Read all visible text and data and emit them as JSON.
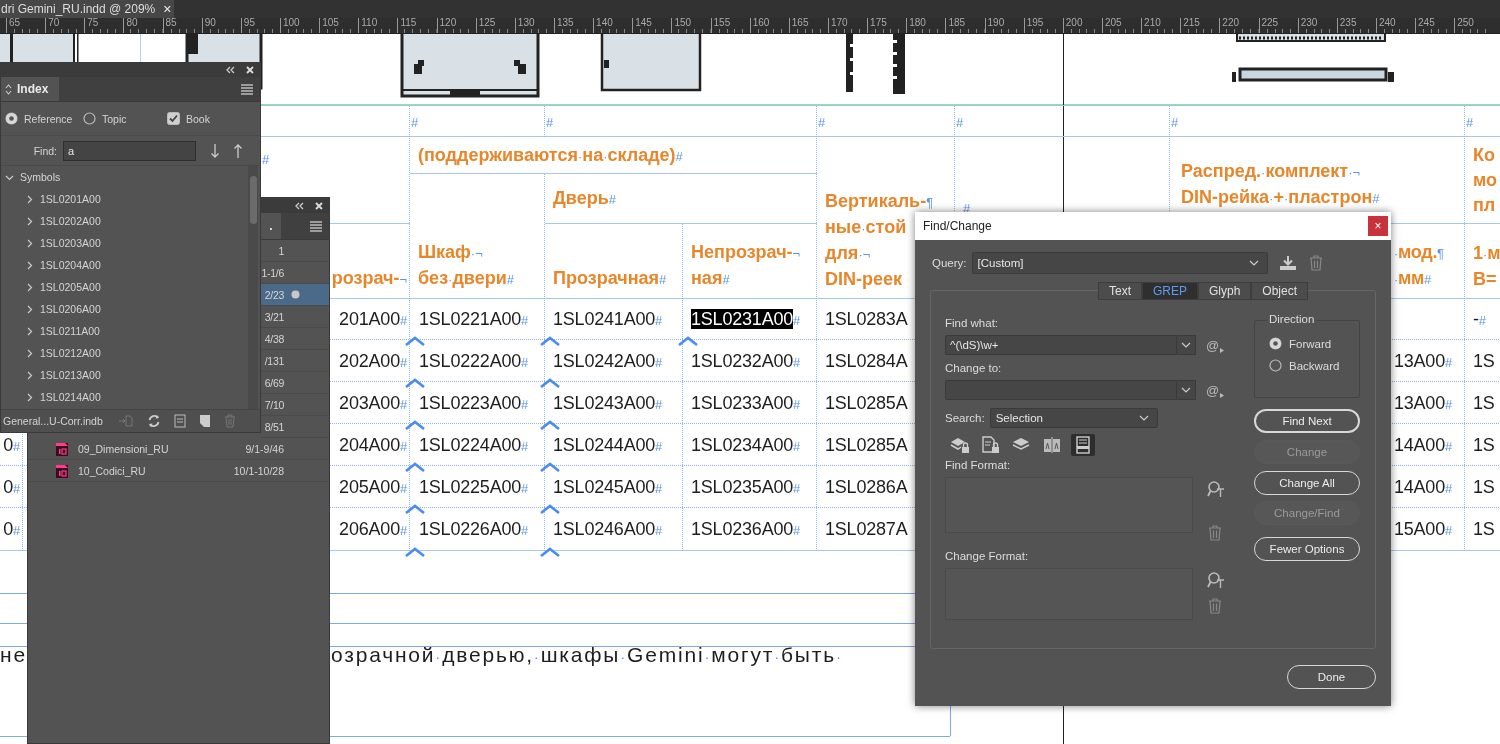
{
  "document_tab": {
    "title": "dri Gemini_RU.indd @ 209%",
    "close": "×"
  },
  "ruler": {
    "labels": [
      "65",
      "70",
      "75",
      "80",
      "85",
      "90",
      "95",
      "100",
      "105",
      "110",
      "115",
      "120",
      "125",
      "130",
      "135",
      "140",
      "145",
      "150",
      "155",
      "160",
      "165",
      "170",
      "175",
      "180",
      "185",
      "190",
      "195",
      "200",
      "205",
      "210",
      "215",
      "220",
      "225",
      "230",
      "235",
      "240",
      "245",
      "250"
    ]
  },
  "table": {
    "header_cells": [
      {
        "text": "#"
      },
      {
        "text": "#"
      },
      {
        "text": "#"
      },
      {
        "text": "#"
      },
      {
        "text": "#"
      },
      {
        "text": "#"
      },
      {
        "text": "#"
      },
      {
        "text": "(поддерживаются·на·складе)#"
      },
      {
        "text": "Вертикаль-¶\nные·стой\nдля·¬\nDIN-реек"
      },
      {
        "text": "#"
      },
      {
        "text": "Распред.·комплект·¬\nDIN-рейка·+·пластрон#"
      },
      {
        "text": "Ко\nмо\nпл"
      },
      {
        "text": "Шкаф·¬\nбез·двери#"
      },
      {
        "text": "Дверь#"
      },
      {
        "text": "розрач-¬"
      },
      {
        "text": "Прозрачная#"
      },
      {
        "text": "Непрозрач-¬\nная#"
      },
      {
        "text": "·мод.¶\n·мм#"
      },
      {
        "text": "1·м\nВ="
      }
    ],
    "rows": [
      {
        "cells": [
          {},
          {
            "text": "201A00#",
            "selected": false,
            "anchored": false
          },
          {
            "text": "1SL0221A00#",
            "selected": false,
            "anchored": true
          },
          {
            "text": "1SL0241A00#",
            "selected": false,
            "anchored": true
          },
          {
            "text": "1SL0231A00#",
            "selected": true,
            "anchored": true
          },
          {
            "text": "1SL0283A",
            "selected": false,
            "anchored": false
          },
          {},
          {},
          {
            "text": "-#",
            "selected": false,
            "anchored": false
          }
        ]
      },
      {
        "cells": [
          {},
          {
            "text": "202A00#",
            "selected": false,
            "anchored": false
          },
          {
            "text": "1SL0222A00#",
            "selected": false,
            "anchored": true
          },
          {
            "text": "1SL0242A00#",
            "selected": false,
            "anchored": true
          },
          {
            "text": "1SL0232A00#",
            "selected": false,
            "anchored": false
          },
          {
            "text": "1SL0284A",
            "selected": false,
            "anchored": false
          },
          {},
          {
            "text": "13A00#",
            "selected": false,
            "anchored": false
          },
          {
            "text": "1S",
            "selected": false,
            "anchored": false
          }
        ]
      },
      {
        "cells": [
          {},
          {
            "text": "203A00#",
            "selected": false,
            "anchored": false
          },
          {
            "text": "1SL0223A00#",
            "selected": false,
            "anchored": true
          },
          {
            "text": "1SL0243A00#",
            "selected": false,
            "anchored": true
          },
          {
            "text": "1SL0233A00#",
            "selected": false,
            "anchored": false
          },
          {
            "text": "1SL0285A",
            "selected": false,
            "anchored": false
          },
          {},
          {
            "text": "13A00#",
            "selected": false,
            "anchored": false
          },
          {
            "text": "1S",
            "selected": false,
            "anchored": false
          }
        ]
      },
      {
        "cells": [
          {
            "text": "0#",
            "selected": false,
            "anchored": false
          },
          {
            "text": "204A00#",
            "selected": false,
            "anchored": false
          },
          {
            "text": "1SL0224A00#",
            "selected": false,
            "anchored": true
          },
          {
            "text": "1SL0244A00#",
            "selected": false,
            "anchored": true
          },
          {
            "text": "1SL0234A00#",
            "selected": false,
            "anchored": false
          },
          {
            "text": "1SL0285A",
            "selected": false,
            "anchored": false
          },
          {},
          {
            "text": "14A00#",
            "selected": false,
            "anchored": false
          },
          {
            "text": "1S",
            "selected": false,
            "anchored": false
          }
        ]
      },
      {
        "cells": [
          {
            "text": "0#",
            "selected": false,
            "anchored": false
          },
          {
            "text": "205A00#",
            "selected": false,
            "anchored": false
          },
          {
            "text": "1SL0225A00#",
            "selected": false,
            "anchored": true
          },
          {
            "text": "1SL0245A00#",
            "selected": false,
            "anchored": true
          },
          {
            "text": "1SL0235A00#",
            "selected": false,
            "anchored": false
          },
          {
            "text": "1SL0286A",
            "selected": false,
            "anchored": false
          },
          {},
          {
            "text": "14A00#",
            "selected": false,
            "anchored": false
          },
          {
            "text": "1S",
            "selected": false,
            "anchored": false
          }
        ]
      },
      {
        "cells": [
          {
            "text": "0#",
            "selected": false,
            "anchored": false
          },
          {
            "text": "206A00#",
            "selected": false,
            "anchored": false
          },
          {
            "text": "1SL0226A00#",
            "selected": false,
            "anchored": true
          },
          {
            "text": "1SL0246A00#",
            "selected": false,
            "anchored": true
          },
          {
            "text": "1SL0236A00#",
            "selected": false,
            "anchored": false
          },
          {
            "text": "1SL0287A",
            "selected": false,
            "anchored": false
          },
          {},
          {
            "text": "15A00#",
            "selected": false,
            "anchored": false
          },
          {
            "text": "1S",
            "selected": false,
            "anchored": false
          }
        ]
      }
    ]
  },
  "body_text": [
    {
      "text": "не"
    },
    {
      "text": "озрачной·дверью,·шкафы·Gemini·могут·быть·"
    }
  ],
  "index_panel": {
    "tabs": [
      {
        "label": "Index",
        "selected": true
      }
    ],
    "options": [
      {
        "kind": "radio",
        "label": "Reference",
        "selected": true
      },
      {
        "kind": "radio",
        "label": "Topic",
        "selected": false
      },
      {
        "kind": "checkbox",
        "label": "Book",
        "checked": true
      }
    ],
    "find": {
      "label": "Find:",
      "value": "a"
    },
    "tree": [
      {
        "label": "Symbols",
        "expanded": true,
        "children": [
          {
            "label": "1SL0201A00",
            "expanded": false
          },
          {
            "label": "1SL0202A00",
            "expanded": false
          },
          {
            "label": "1SL0203A00",
            "expanded": false
          },
          {
            "label": "1SL0204A00",
            "expanded": false
          },
          {
            "label": "1SL0205A00",
            "expanded": false
          },
          {
            "label": "1SL0206A00",
            "expanded": false
          },
          {
            "label": "1SL0211A00",
            "expanded": false
          },
          {
            "label": "1SL0212A00",
            "expanded": false
          },
          {
            "label": "1SL0213A00",
            "expanded": false
          },
          {
            "label": "1SL0214A00",
            "expanded": false
          }
        ]
      }
    ],
    "footer": {
      "file": "General...U-Corr.indb"
    }
  },
  "book_panel": {
    "tabs": [
      {
        "label": ".",
        "selected": true
      }
    ],
    "rows": [
      {
        "pages": "1",
        "selected": false,
        "open": false
      },
      {
        "pages": "1-1/6",
        "selected": false,
        "open": false
      },
      {
        "pages": "2/23",
        "selected": true,
        "open": true
      },
      {
        "pages": "3/21",
        "selected": false,
        "open": false
      },
      {
        "pages": "4/38",
        "selected": false,
        "open": false
      },
      {
        "pages": "/131",
        "selected": false,
        "open": false
      },
      {
        "pages": "6/69",
        "selected": false,
        "open": false
      },
      {
        "pages": "7/10",
        "selected": false,
        "open": false
      },
      {
        "pages": "8/51",
        "selected": false,
        "open": false
      },
      {
        "name": "09_Dimensioni_RU",
        "pages": "9/1-9/46",
        "selected": false,
        "open": false
      },
      {
        "name": "10_Codici_RU",
        "pages": "10/1-10/28",
        "selected": false,
        "open": false
      }
    ]
  },
  "dialog": {
    "title": "Find/Change",
    "close": "×",
    "query": {
      "label": "Query:",
      "value": "[Custom]"
    },
    "tabs": [
      {
        "label": "Text",
        "selected": false
      },
      {
        "label": "GREP",
        "selected": true
      },
      {
        "label": "Glyph",
        "selected": false
      },
      {
        "label": "Object",
        "selected": false
      }
    ],
    "find_what": {
      "label": "Find what:",
      "value": "^(\\dS)\\w+",
      "menu": "@"
    },
    "change_to": {
      "label": "Change to:",
      "menu": "@"
    },
    "search": {
      "label": "Search:",
      "value": "Selection"
    },
    "search_options": [
      {
        "kind": "locked-layers",
        "on": false
      },
      {
        "kind": "locked-stories",
        "on": false
      },
      {
        "kind": "hidden-layers",
        "on": false
      },
      {
        "kind": "master-pages",
        "on": false
      },
      {
        "kind": "footnotes",
        "on": true
      }
    ],
    "find_format": {
      "label": "Find Format:"
    },
    "change_format": {
      "label": "Change Format:"
    },
    "direction": {
      "label": "Direction",
      "options": [
        {
          "label": "Forward",
          "selected": true
        },
        {
          "label": "Backward",
          "selected": false
        }
      ]
    },
    "buttons": [
      {
        "label": "Find Next",
        "kind": "default",
        "disabled": false
      },
      {
        "label": "Change",
        "kind": "normal",
        "disabled": true
      },
      {
        "label": "Change All",
        "kind": "normal",
        "disabled": false
      },
      {
        "label": "Change/Find",
        "kind": "normal",
        "disabled": true
      },
      {
        "label": "Fewer Options",
        "kind": "normal",
        "disabled": false
      }
    ],
    "done": "Done"
  }
}
